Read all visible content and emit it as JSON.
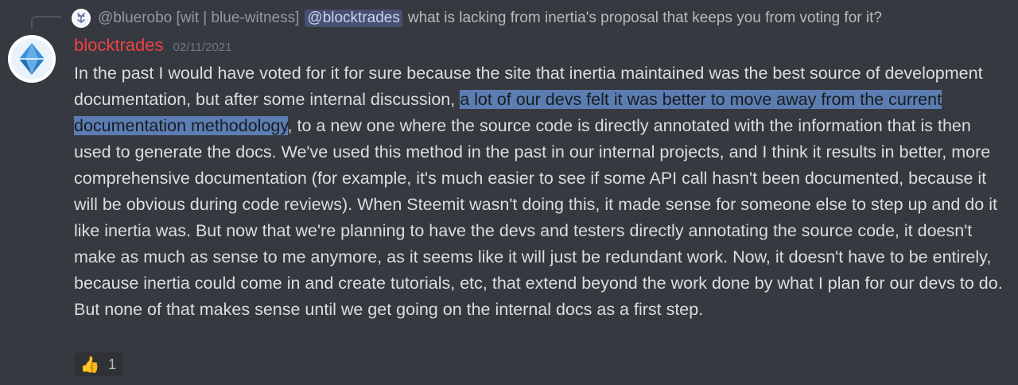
{
  "reply": {
    "author": "@bluerobo [wit | blue-witness]",
    "mention": "@blocktrades",
    "text": "what is lacking from inertia's proposal that keeps you from voting for it?",
    "avatar_icon": "robot-avatar-icon"
  },
  "message": {
    "author": "blocktrades",
    "author_color": "#ed4245",
    "timestamp": "02/11/2021",
    "avatar_icon": "blocktrades-logo-icon",
    "text_before": "In the past I would have voted for it for sure because the site that inertia maintained was the best source of development documentation, but after some internal discussion, ",
    "text_highlight": "a lot of our devs felt it was better to move away from the current documentation methodology",
    "text_after": ", to a new one where the source code is directly annotated with the information that is then used to generate the docs. We've used this method in the past in our internal projects, and I think it results in better, more comprehensive documentation (for example, it's much easier to see if some API call hasn't been documented, because it will be obvious during code reviews). When Steemit wasn't doing this, it made sense for someone else to step up and do it like inertia was. But now that we're planning to have the devs and testers directly annotating the source code, it doesn't make as much as sense to me anymore, as it seems like it will just be redundant work. Now, it doesn't have to be entirely, because inertia could come in and create tutorials, etc, that extend beyond the work done by what I plan for our devs to do. But none of that makes sense until we get going on the internal docs as a first step."
  },
  "reactions": [
    {
      "emoji": "👍",
      "emoji_name": "thumbs-up-icon",
      "count": "1"
    }
  ],
  "colors": {
    "background": "#36393f",
    "highlight": "#5b7db1",
    "mention_bg": "#3f4a6e"
  }
}
